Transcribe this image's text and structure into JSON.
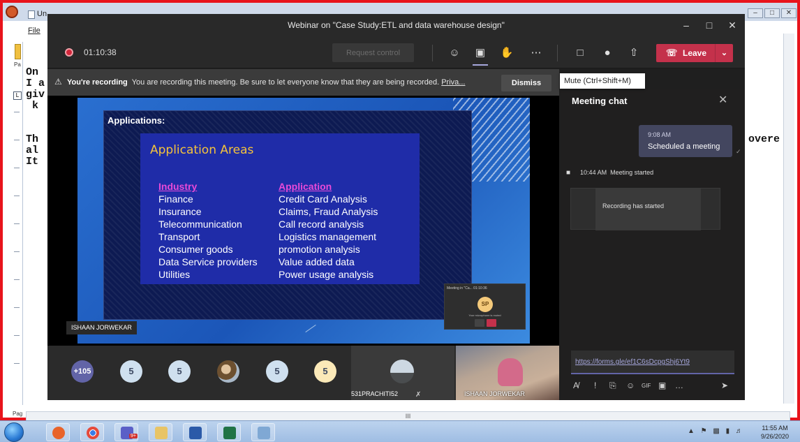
{
  "background_window": {
    "title_prefix": "Un",
    "menu_file": "File",
    "left_strip_label": "Pa",
    "left_strip_bottom_label": "Pag",
    "text_lines": [
      "On",
      "I a",
      "giv",
      " k",
      "",
      "Th",
      "al",
      "It"
    ],
    "overflow_text": "overe",
    "hscroll_label": "III",
    "controls": [
      "–",
      "□",
      "✕"
    ]
  },
  "teams": {
    "window_title": "Webinar on \"Case Study:ETL and data warehouse design\"",
    "window_controls": [
      "–",
      "□",
      "✕"
    ],
    "recording_time": "01:10:38",
    "request_control_label": "Request control",
    "leave_label": "Leave",
    "tooltip": "Mute (Ctrl+Shift+M)",
    "banner": {
      "bold": "You're recording",
      "text": "You are recording this meeting. Be sure to let everyone know that they are being recorded.",
      "link": "Priva...",
      "dismiss": "Dismiss"
    },
    "slide": {
      "heading": "Applications:",
      "title": "Application Areas",
      "col1_header": "Industry",
      "col2_header": "Application",
      "rows": [
        [
          "Finance",
          "Credit Card Analysis"
        ],
        [
          "Insurance",
          "Claims, Fraud Analysis"
        ],
        [
          "Telecommunication",
          "Call record analysis"
        ],
        [
          "Transport",
          "Logistics management"
        ],
        [
          "Consumer goods",
          "promotion analysis"
        ],
        [
          "Data Service providers",
          "Value added data"
        ],
        [
          "Utilities",
          "Power usage analysis"
        ]
      ]
    },
    "presenter_name": "ISHAAN JORWEKAR",
    "mini_preview": {
      "title": "Meeting in \"Ca...  01:10:36",
      "avatar_initials": "SP",
      "status": "Your microphone is muted"
    },
    "participants": {
      "more": "+105",
      "counts": [
        "5",
        "5",
        "5",
        "5"
      ],
      "tile1_name": "531PRACHITI52",
      "tile2_name": "ISHAAN JORWEKAR"
    },
    "chat": {
      "title": "Meeting chat",
      "message_time": "9:08 AM",
      "message_text": "Scheduled a meeting",
      "event_time": "10:44 AM",
      "event_text": "Meeting started",
      "card_text": "Recording has started",
      "input_value": "https://forms.gle/ef1C6sDcpgShj6Yt9",
      "tools": [
        "A̸",
        "!",
        "⎘",
        "☺",
        "GIF",
        "▣",
        "…",
        "➤"
      ]
    }
  },
  "taskbar": {
    "time": "11:55 AM",
    "date": "9/26/2020",
    "teams_badge": "9+"
  },
  "colors": {
    "frame_red": "#e8141c",
    "teams_leave": "#c4314b",
    "teams_accent": "#6264a7",
    "slide_title": "#f5c33b",
    "slide_headers": "#e84ad8"
  }
}
